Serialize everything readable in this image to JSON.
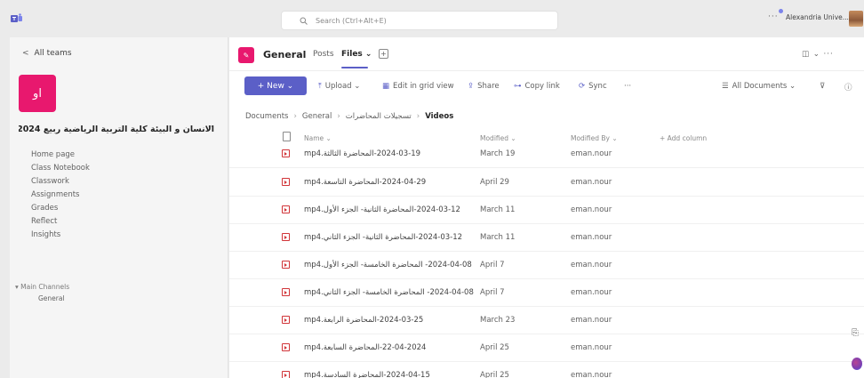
{
  "titlebar": {
    "search_placeholder": "Search (Ctrl+Alt+E)",
    "more": "···",
    "account_name": "Alexandria Unive..."
  },
  "left": {
    "back_label": "All teams",
    "team_initials": "او",
    "team_name": "الانسان و البيئة كلية التربية الرياضية ربيع 2024",
    "team_more": "···",
    "nav": [
      "Home page",
      "Class Notebook",
      "Classwork",
      "Assignments",
      "Grades",
      "Reflect",
      "Insights"
    ],
    "channels_heading": "▾ Main Channels",
    "channel": "General"
  },
  "main": {
    "channel_name": "General",
    "tabs": {
      "posts": "Posts",
      "files": "Files ⌄",
      "add": "+"
    },
    "header_right": "◫ ⌄  ···",
    "toolbar": {
      "new": "+ New ⌄",
      "upload": "Upload ⌄",
      "edit_grid": "Edit in grid view",
      "share": "Share",
      "copy_link": "Copy link",
      "sync": "Sync",
      "more": "···",
      "all_documents": "All Documents ⌄",
      "filter": "⊽",
      "info": "ⓘ"
    },
    "breadcrumb": {
      "documents": "Documents",
      "general": "General",
      "recordings": "تسجيلات المحاضرات",
      "videos": "Videos"
    },
    "columns": {
      "name": "Name ⌄",
      "modified": "Modified ⌄",
      "modified_by": "Modified By ⌄",
      "add_column": "+ Add column"
    },
    "files": [
      {
        "name": "2024-03-19-المحاضرة الثالثة.mp4",
        "modified": "March 19",
        "by": "eman.nour"
      },
      {
        "name": "2024-04-29-المحاضرة التاسعة.mp4",
        "modified": "April 29",
        "by": "eman.nour"
      },
      {
        "name": "2024-03-12-المحاضرة الثانية- الجزء الأول.mp4",
        "modified": "March 11",
        "by": "eman.nour"
      },
      {
        "name": "2024-03-12-المحاضرة الثانية- الجزء الثاني.mp4",
        "modified": "March 11",
        "by": "eman.nour"
      },
      {
        "name": "2024-04-08- المحاضرة الخامسة- الجزء الأول.mp4",
        "modified": "April 7",
        "by": "eman.nour"
      },
      {
        "name": "2024-04-08- المحاضرة الخامسة- الجزء الثاني.mp4",
        "modified": "April 7",
        "by": "eman.nour"
      },
      {
        "name": "2024-03-25-المحاضرة الرابعة.mp4",
        "modified": "March 23",
        "by": "eman.nour"
      },
      {
        "name": "22-04-2024-المحاضرة السابعة.mp4",
        "modified": "April 25",
        "by": "eman.nour"
      },
      {
        "name": "2024-04-15-المحاضرة السادسة.mp4",
        "modified": "April 25",
        "by": "eman.nour"
      }
    ]
  }
}
